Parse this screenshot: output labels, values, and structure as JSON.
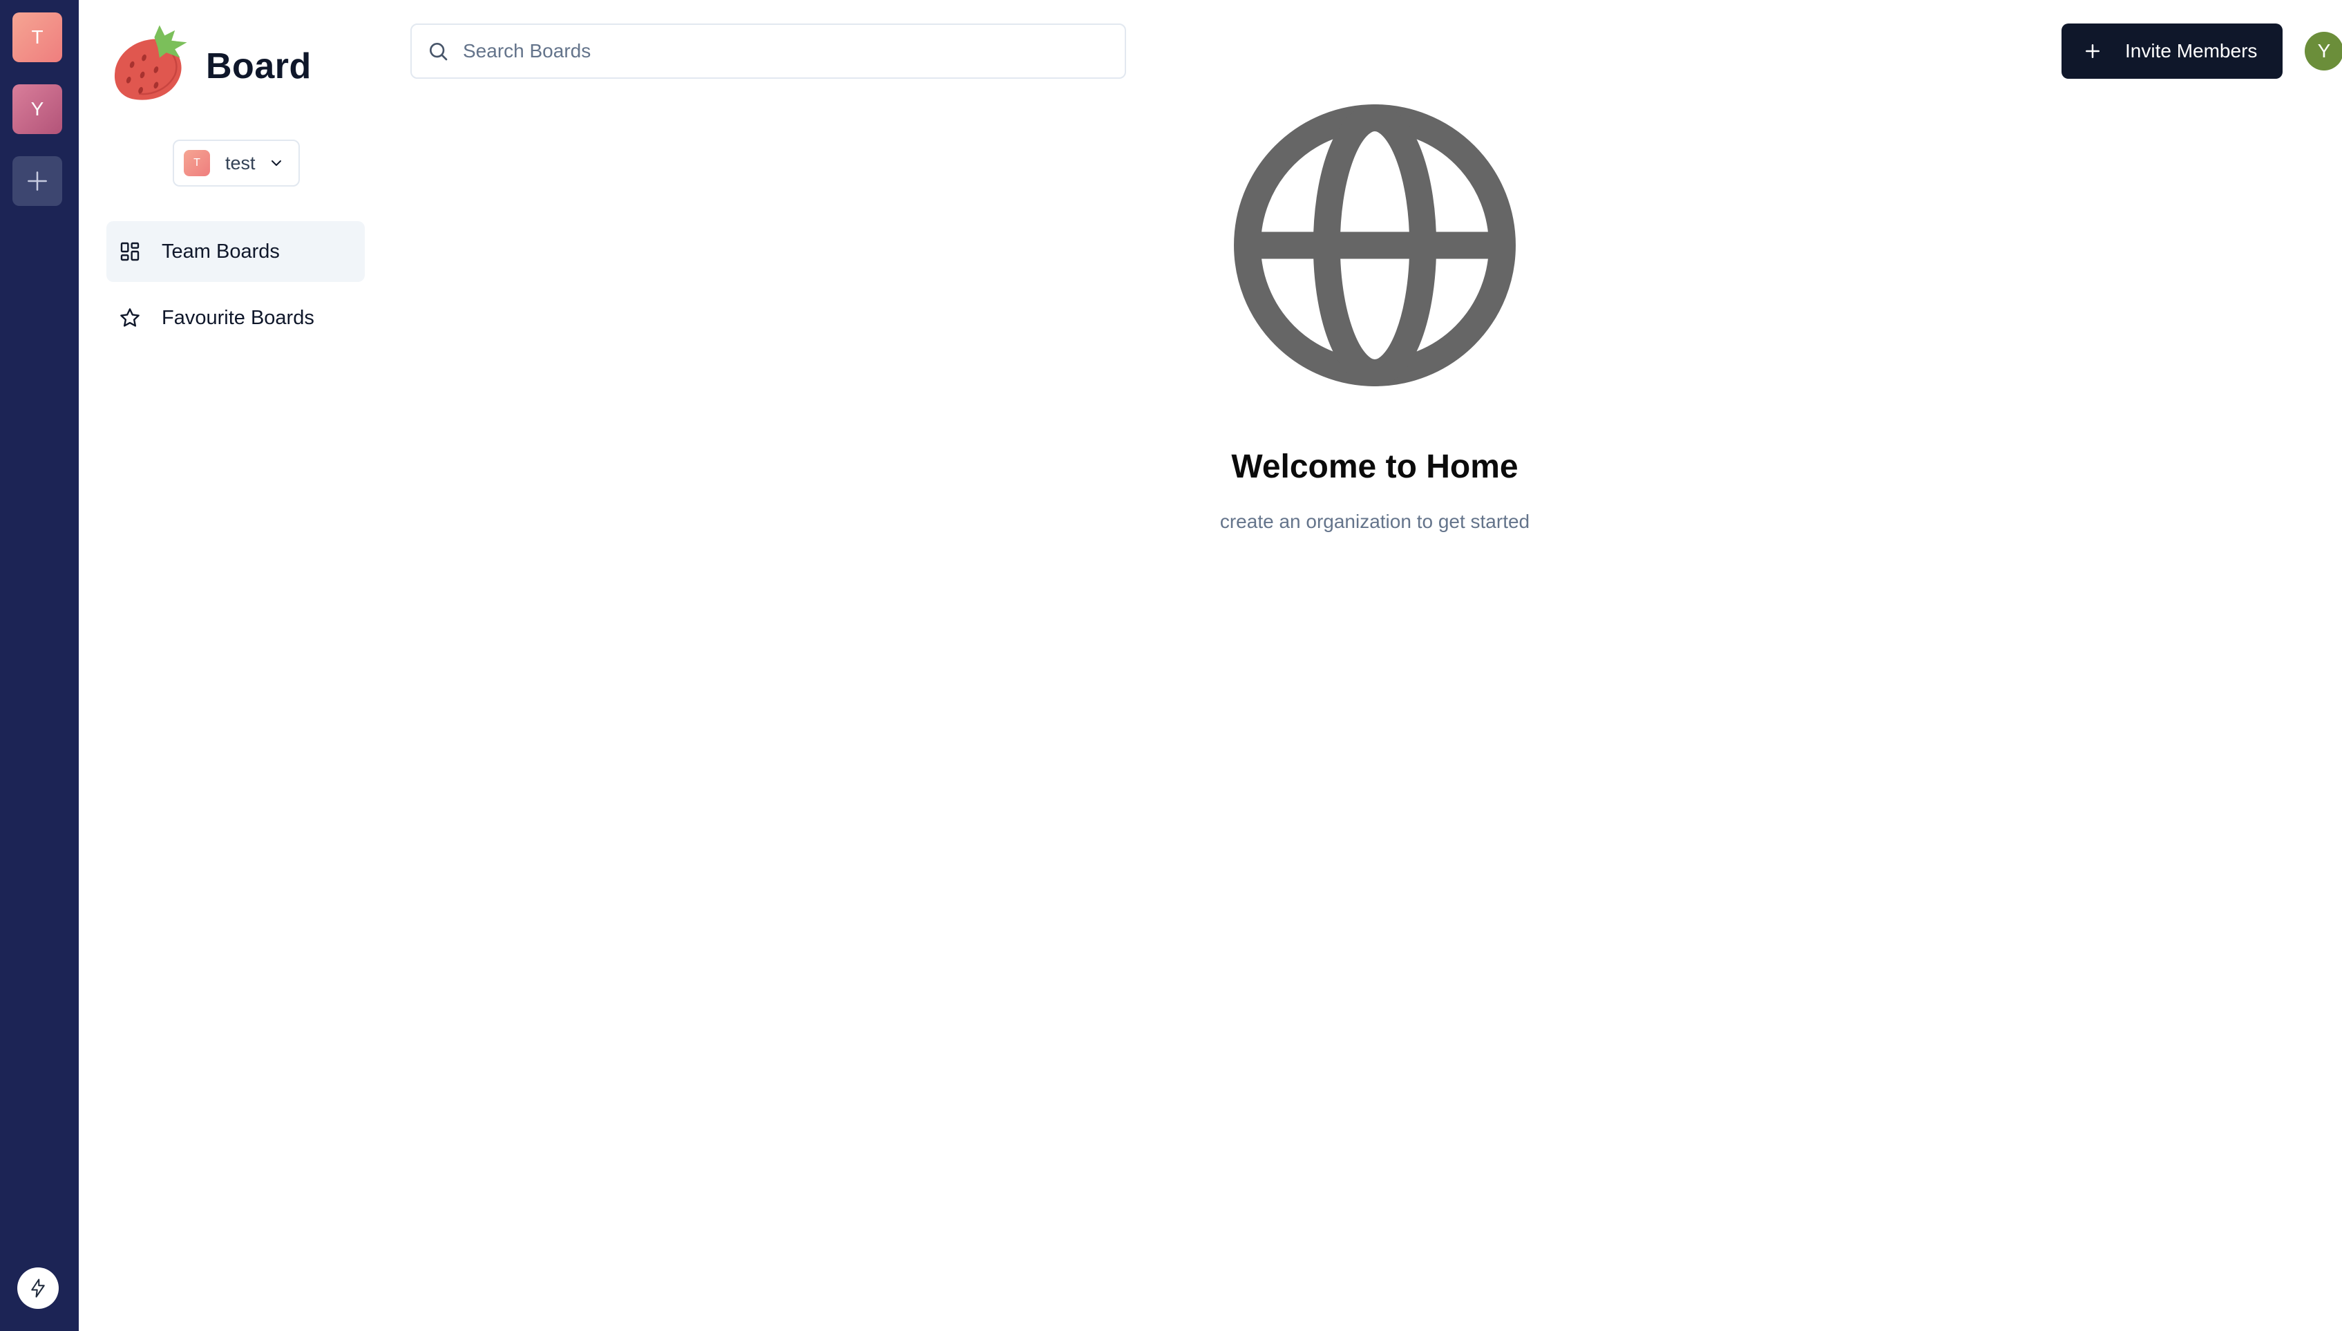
{
  "org_rail": {
    "orgs": [
      {
        "initial": "T",
        "color": "#ef8a80"
      },
      {
        "initial": "Y",
        "color": "#c0658a"
      }
    ],
    "add_icon": "plus-icon",
    "bottom_icon": "lightning-icon"
  },
  "sidebar": {
    "brand": {
      "name": "Board",
      "logo": "strawberry-logo"
    },
    "org_switcher": {
      "initial": "T",
      "name": "test",
      "icon": "chevron-down-icon"
    },
    "nav": [
      {
        "label": "Team Boards",
        "icon": "grid-icon",
        "active": true
      },
      {
        "label": "Favourite Boards",
        "icon": "star-icon",
        "active": false
      }
    ]
  },
  "header": {
    "search": {
      "placeholder": "Search Boards",
      "value": "",
      "icon": "search-icon"
    },
    "invite_button": {
      "label": "Invite Members",
      "icon": "plus-icon"
    },
    "user_avatar": {
      "initial": "Y",
      "color": "#6b8e3a"
    }
  },
  "main": {
    "icon": "globe-icon",
    "title": "Welcome to Home",
    "subtitle": "create an organization to get started"
  },
  "colors": {
    "rail_bg": "#1c2455",
    "primary_button": "#0f172a",
    "active_nav_bg": "#f1f5f9",
    "globe": "#666666"
  }
}
